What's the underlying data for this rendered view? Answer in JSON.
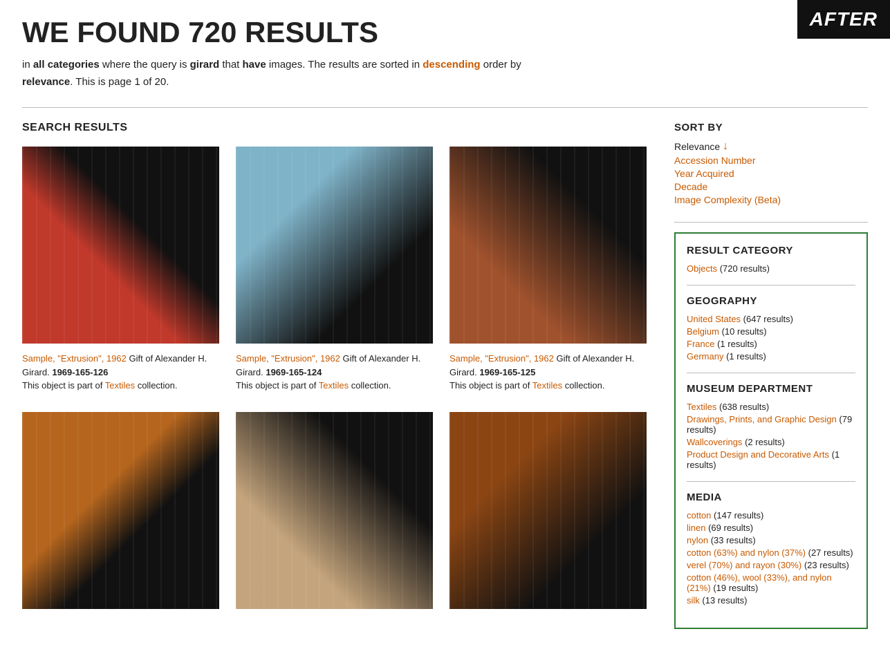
{
  "logo": {
    "text": "AFTER"
  },
  "header": {
    "title": "WE FOUND 720 RESULTS",
    "subtitle_parts": {
      "prefix": "in ",
      "category": "all categories",
      "middle": " where the query is ",
      "query": "girard",
      "have": " that ",
      "have_word": "have",
      "images": " images. The results are sorted in ",
      "sort_order": "descending",
      "suffix": " order by"
    },
    "page_info": "relevance. This is page 1 of 20."
  },
  "search_results_label": "SEARCH RESULTS",
  "sort_by": {
    "label": "SORT BY",
    "items": [
      {
        "label": "Relevance",
        "active": true,
        "arrow": "↓"
      },
      {
        "label": "Accession Number",
        "active": false
      },
      {
        "label": "Year Acquired",
        "active": false
      },
      {
        "label": "Decade",
        "active": false
      },
      {
        "label": "Image Complexity (Beta)",
        "active": false
      }
    ]
  },
  "results": [
    {
      "id": 1,
      "title": "Sample, \"Extrusion\", 1962",
      "description": "Gift of Alexander H. Girard.",
      "accession": "1969-165-126",
      "collection": "Textiles",
      "image_style": "img-red"
    },
    {
      "id": 2,
      "title": "Sample, \"Extrusion\", 1962",
      "description": "Gift of Alexander H. Girard.",
      "accession": "1969-165-124",
      "collection": "Textiles",
      "image_style": "img-blue"
    },
    {
      "id": 3,
      "title": "Sample, \"Extrusion\", 1962",
      "description": "Gift of Alexander H. Girard.",
      "accession": "1969-165-125",
      "collection": "Textiles",
      "image_style": "img-brown"
    },
    {
      "id": 4,
      "title": "",
      "description": "",
      "accession": "",
      "collection": "",
      "image_style": "img-brown2"
    },
    {
      "id": 5,
      "title": "",
      "description": "",
      "accession": "",
      "collection": "",
      "image_style": "img-tan"
    },
    {
      "id": 6,
      "title": "",
      "description": "",
      "accession": "",
      "collection": "",
      "image_style": "img-russet"
    }
  ],
  "filters": {
    "result_category": {
      "label": "RESULT CATEGORY",
      "items": [
        {
          "label": "Objects",
          "count": "(720 results)"
        }
      ]
    },
    "geography": {
      "label": "GEOGRAPHY",
      "items": [
        {
          "label": "United States",
          "count": "(647 results)"
        },
        {
          "label": "Belgium",
          "count": "(10 results)"
        },
        {
          "label": "France",
          "count": "(1 results)"
        },
        {
          "label": "Germany",
          "count": "(1 results)"
        }
      ]
    },
    "museum_department": {
      "label": "MUSEUM DEPARTMENT",
      "items": [
        {
          "label": "Textiles",
          "count": "(638 results)"
        },
        {
          "label": "Drawings, Prints, and Graphic Design",
          "count": "(79 results)"
        },
        {
          "label": "Wallcoverings",
          "count": "(2 results)"
        },
        {
          "label": "Product Design and Decorative Arts",
          "count": "(1 results)"
        }
      ]
    },
    "media": {
      "label": "MEDIA",
      "items": [
        {
          "label": "cotton",
          "count": "(147 results)"
        },
        {
          "label": "linen",
          "count": "(69 results)"
        },
        {
          "label": "nylon",
          "count": "(33 results)"
        },
        {
          "label": "cotton (63%) and nylon (37%)",
          "count": "(27 results)"
        },
        {
          "label": "verel (70%) and rayon (30%)",
          "count": "(23 results)"
        },
        {
          "label": "cotton (46%), wool (33%), and nylon (21%)",
          "count": "(19 results)"
        },
        {
          "label": "silk",
          "count": "(13 results)"
        }
      ]
    }
  }
}
